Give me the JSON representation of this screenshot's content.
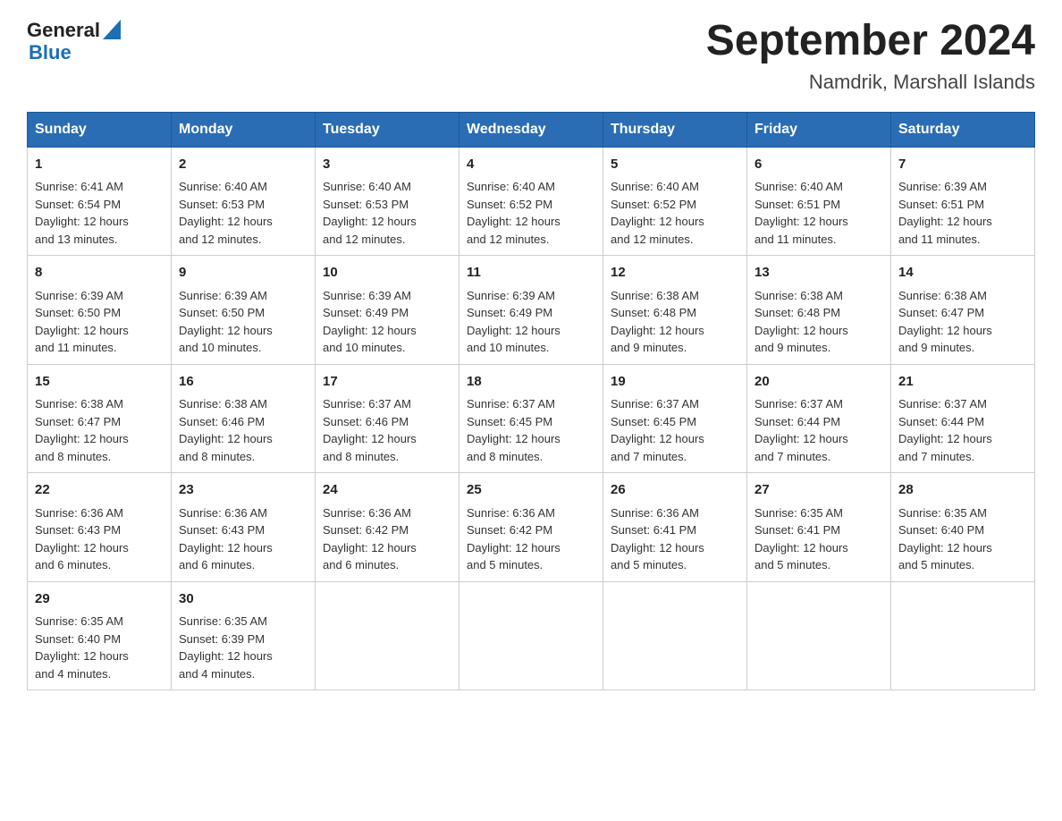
{
  "header": {
    "logo_general": "General",
    "logo_blue": "Blue",
    "title": "September 2024",
    "subtitle": "Namdrik, Marshall Islands"
  },
  "days_of_week": [
    "Sunday",
    "Monday",
    "Tuesday",
    "Wednesday",
    "Thursday",
    "Friday",
    "Saturday"
  ],
  "weeks": [
    [
      {
        "day": "1",
        "sunrise": "6:41 AM",
        "sunset": "6:54 PM",
        "daylight": "12 hours and 13 minutes."
      },
      {
        "day": "2",
        "sunrise": "6:40 AM",
        "sunset": "6:53 PM",
        "daylight": "12 hours and 12 minutes."
      },
      {
        "day": "3",
        "sunrise": "6:40 AM",
        "sunset": "6:53 PM",
        "daylight": "12 hours and 12 minutes."
      },
      {
        "day": "4",
        "sunrise": "6:40 AM",
        "sunset": "6:52 PM",
        "daylight": "12 hours and 12 minutes."
      },
      {
        "day": "5",
        "sunrise": "6:40 AM",
        "sunset": "6:52 PM",
        "daylight": "12 hours and 12 minutes."
      },
      {
        "day": "6",
        "sunrise": "6:40 AM",
        "sunset": "6:51 PM",
        "daylight": "12 hours and 11 minutes."
      },
      {
        "day": "7",
        "sunrise": "6:39 AM",
        "sunset": "6:51 PM",
        "daylight": "12 hours and 11 minutes."
      }
    ],
    [
      {
        "day": "8",
        "sunrise": "6:39 AM",
        "sunset": "6:50 PM",
        "daylight": "12 hours and 11 minutes."
      },
      {
        "day": "9",
        "sunrise": "6:39 AM",
        "sunset": "6:50 PM",
        "daylight": "12 hours and 10 minutes."
      },
      {
        "day": "10",
        "sunrise": "6:39 AM",
        "sunset": "6:49 PM",
        "daylight": "12 hours and 10 minutes."
      },
      {
        "day": "11",
        "sunrise": "6:39 AM",
        "sunset": "6:49 PM",
        "daylight": "12 hours and 10 minutes."
      },
      {
        "day": "12",
        "sunrise": "6:38 AM",
        "sunset": "6:48 PM",
        "daylight": "12 hours and 9 minutes."
      },
      {
        "day": "13",
        "sunrise": "6:38 AM",
        "sunset": "6:48 PM",
        "daylight": "12 hours and 9 minutes."
      },
      {
        "day": "14",
        "sunrise": "6:38 AM",
        "sunset": "6:47 PM",
        "daylight": "12 hours and 9 minutes."
      }
    ],
    [
      {
        "day": "15",
        "sunrise": "6:38 AM",
        "sunset": "6:47 PM",
        "daylight": "12 hours and 8 minutes."
      },
      {
        "day": "16",
        "sunrise": "6:38 AM",
        "sunset": "6:46 PM",
        "daylight": "12 hours and 8 minutes."
      },
      {
        "day": "17",
        "sunrise": "6:37 AM",
        "sunset": "6:46 PM",
        "daylight": "12 hours and 8 minutes."
      },
      {
        "day": "18",
        "sunrise": "6:37 AM",
        "sunset": "6:45 PM",
        "daylight": "12 hours and 8 minutes."
      },
      {
        "day": "19",
        "sunrise": "6:37 AM",
        "sunset": "6:45 PM",
        "daylight": "12 hours and 7 minutes."
      },
      {
        "day": "20",
        "sunrise": "6:37 AM",
        "sunset": "6:44 PM",
        "daylight": "12 hours and 7 minutes."
      },
      {
        "day": "21",
        "sunrise": "6:37 AM",
        "sunset": "6:44 PM",
        "daylight": "12 hours and 7 minutes."
      }
    ],
    [
      {
        "day": "22",
        "sunrise": "6:36 AM",
        "sunset": "6:43 PM",
        "daylight": "12 hours and 6 minutes."
      },
      {
        "day": "23",
        "sunrise": "6:36 AM",
        "sunset": "6:43 PM",
        "daylight": "12 hours and 6 minutes."
      },
      {
        "day": "24",
        "sunrise": "6:36 AM",
        "sunset": "6:42 PM",
        "daylight": "12 hours and 6 minutes."
      },
      {
        "day": "25",
        "sunrise": "6:36 AM",
        "sunset": "6:42 PM",
        "daylight": "12 hours and 5 minutes."
      },
      {
        "day": "26",
        "sunrise": "6:36 AM",
        "sunset": "6:41 PM",
        "daylight": "12 hours and 5 minutes."
      },
      {
        "day": "27",
        "sunrise": "6:35 AM",
        "sunset": "6:41 PM",
        "daylight": "12 hours and 5 minutes."
      },
      {
        "day": "28",
        "sunrise": "6:35 AM",
        "sunset": "6:40 PM",
        "daylight": "12 hours and 5 minutes."
      }
    ],
    [
      {
        "day": "29",
        "sunrise": "6:35 AM",
        "sunset": "6:40 PM",
        "daylight": "12 hours and 4 minutes."
      },
      {
        "day": "30",
        "sunrise": "6:35 AM",
        "sunset": "6:39 PM",
        "daylight": "12 hours and 4 minutes."
      },
      null,
      null,
      null,
      null,
      null
    ]
  ],
  "labels": {
    "sunrise": "Sunrise:",
    "sunset": "Sunset:",
    "daylight": "Daylight:"
  }
}
